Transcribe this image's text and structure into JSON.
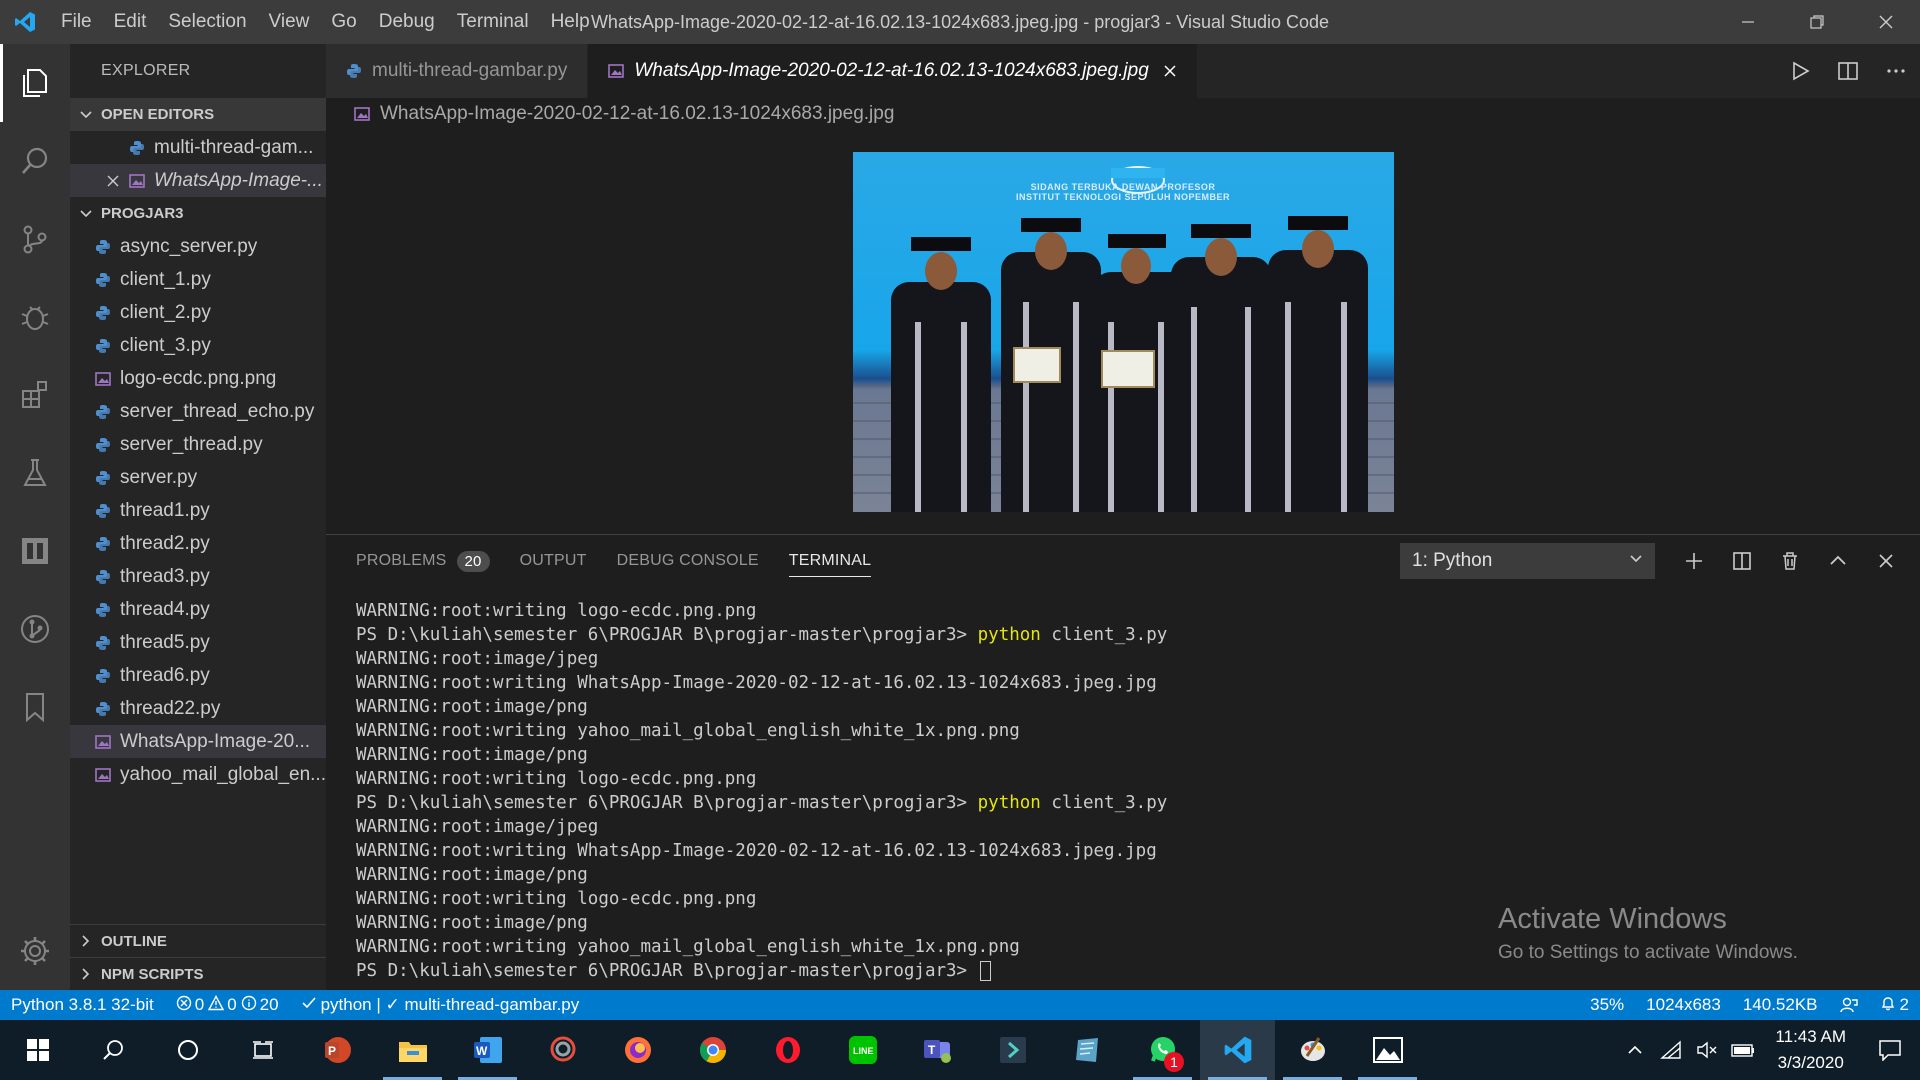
{
  "window": {
    "title": "WhatsApp-Image-2020-02-12-at-16.02.13-1024x683.jpeg.jpg - progjar3 - Visual Studio Code",
    "menu": [
      "File",
      "Edit",
      "Selection",
      "View",
      "Go",
      "Debug",
      "Terminal",
      "Help"
    ]
  },
  "sidebar": {
    "title": "EXPLORER",
    "open_editors_label": "OPEN EDITORS",
    "open_editors": [
      "multi-thread-gam...",
      "WhatsApp-Image-..."
    ],
    "project_label": "PROGJAR3",
    "files": [
      {
        "name": "async_server.py",
        "type": "python"
      },
      {
        "name": "client_1.py",
        "type": "python"
      },
      {
        "name": "client_2.py",
        "type": "python"
      },
      {
        "name": "client_3.py",
        "type": "python"
      },
      {
        "name": "logo-ecdc.png.png",
        "type": "image"
      },
      {
        "name": "server_thread_echo.py",
        "type": "python"
      },
      {
        "name": "server_thread.py",
        "type": "python"
      },
      {
        "name": "server.py",
        "type": "python"
      },
      {
        "name": "thread1.py",
        "type": "python"
      },
      {
        "name": "thread2.py",
        "type": "python"
      },
      {
        "name": "thread3.py",
        "type": "python"
      },
      {
        "name": "thread4.py",
        "type": "python"
      },
      {
        "name": "thread5.py",
        "type": "python"
      },
      {
        "name": "thread6.py",
        "type": "python"
      },
      {
        "name": "thread22.py",
        "type": "python"
      },
      {
        "name": "WhatsApp-Image-20...",
        "type": "image"
      },
      {
        "name": "yahoo_mail_global_en...",
        "type": "image"
      }
    ],
    "outline_label": "OUTLINE",
    "npm_label": "NPM SCRIPTS"
  },
  "tabs": [
    {
      "label": "multi-thread-gambar.py",
      "icon": "python-icon",
      "active": false
    },
    {
      "label": "WhatsApp-Image-2020-02-12-at-16.02.13-1024x683.jpeg.jpg",
      "icon": "image-icon",
      "active": true
    }
  ],
  "breadcrumb": "WhatsApp-Image-2020-02-12-at-16.02.13-1024x683.jpeg.jpg",
  "image_banner": {
    "line1": "SIDANG TERBUKA DEWAN PROFESOR",
    "line2": "INSTITUT TEKNOLOGI SEPULUH NOPEMBER"
  },
  "panel": {
    "tabs": {
      "problems": "PROBLEMS",
      "problems_count": "20",
      "output": "OUTPUT",
      "debug": "DEBUG CONSOLE",
      "terminal": "TERMINAL"
    },
    "terminal_select": "1: Python",
    "lines": [
      {
        "text": "WARNING:root:writing logo-ecdc.png.png"
      },
      {
        "prompt": "PS D:\\kuliah\\semester 6\\PROGJAR B\\progjar-master\\progjar3> ",
        "cmd": "python",
        "rest": " client_3.py"
      },
      {
        "text": "WARNING:root:image/jpeg"
      },
      {
        "text": "WARNING:root:writing WhatsApp-Image-2020-02-12-at-16.02.13-1024x683.jpeg.jpg"
      },
      {
        "text": "WARNING:root:image/png"
      },
      {
        "text": "WARNING:root:writing yahoo_mail_global_english_white_1x.png.png"
      },
      {
        "text": "WARNING:root:image/png"
      },
      {
        "text": "WARNING:root:writing logo-ecdc.png.png"
      },
      {
        "prompt": "PS D:\\kuliah\\semester 6\\PROGJAR B\\progjar-master\\progjar3> ",
        "cmd": "python",
        "rest": " client_3.py"
      },
      {
        "text": "WARNING:root:image/jpeg"
      },
      {
        "text": "WARNING:root:writing WhatsApp-Image-2020-02-12-at-16.02.13-1024x683.jpeg.jpg"
      },
      {
        "text": "WARNING:root:image/png"
      },
      {
        "text": "WARNING:root:writing logo-ecdc.png.png"
      },
      {
        "text": "WARNING:root:image/png"
      },
      {
        "text": "WARNING:root:writing yahoo_mail_global_english_white_1x.png.png"
      },
      {
        "prompt": "PS D:\\kuliah\\semester 6\\PROGJAR B\\progjar-master\\progjar3> ",
        "cursor": true
      }
    ],
    "watermark_title": "Activate Windows",
    "watermark_sub": "Go to Settings to activate Windows."
  },
  "statusbar": {
    "python": "Python 3.8.1 32-bit",
    "errors": "0",
    "warnings": "0",
    "infos": "20",
    "lint": "python | ✓ multi-thread-gambar.py",
    "zoom": "35%",
    "dimensions": "1024x683",
    "size": "140.52KB",
    "notifications": "2"
  },
  "taskbar": {
    "time": "11:43 AM",
    "date": "3/3/2020",
    "whatsapp_badge": "1"
  },
  "colors": {
    "accent": "#007acc",
    "python_icon": "#4f8fcf",
    "image_icon": "#a074c4",
    "terminal_command": "#e5e510"
  }
}
